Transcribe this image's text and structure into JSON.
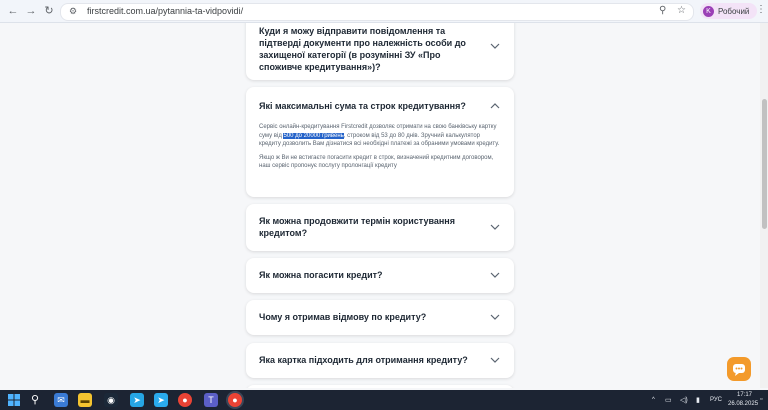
{
  "browser": {
    "url": "firstcredit.com.ua/pytannia-ta-vidpovidi/",
    "profile_initial": "K",
    "profile_name": "Робочий"
  },
  "faq": [
    {
      "question": "Куди я можу відправити повідомлення та підтверді документи про належність особи до захищеної категорії (в розумінні ЗУ «Про споживче кредитування»)?",
      "expanded": false
    },
    {
      "question": "Які максимальні сума та строк кредитування?",
      "expanded": true,
      "answer_part1": "Сервіс онлайн-кредитування Firstcredit дозволяє отримати на свою банківську картку суму від ",
      "answer_highlight": "500 до 20000 гривень",
      "answer_part2": ", строком від 53 до 80 днів. Зручний калькулятор кредиту дозволить Вам дізнатися всі необхідні платежі за обраними умовами кредиту.",
      "answer_para2": "Якщо ж Ви не встигаєте погасити кредит в строк, визначений кредитним договором, наш сервіс пропонує послугу пролонгації кредиту"
    },
    {
      "question": "Як можна продовжити термін користування кредитом?",
      "expanded": false
    },
    {
      "question": "Як можна погасити кредит?",
      "expanded": false
    },
    {
      "question": "Чому я отримав відмову по кредиту?",
      "expanded": false
    },
    {
      "question": "Яка картка підходить для отримання кредиту?",
      "expanded": false
    }
  ],
  "taskbar": {
    "language": "РУС",
    "time": "17:17",
    "date": "26.08.2025"
  },
  "colors": {
    "accent": "#f39a2b",
    "highlight": "#2563c9",
    "taskbar": "#1c2433"
  }
}
